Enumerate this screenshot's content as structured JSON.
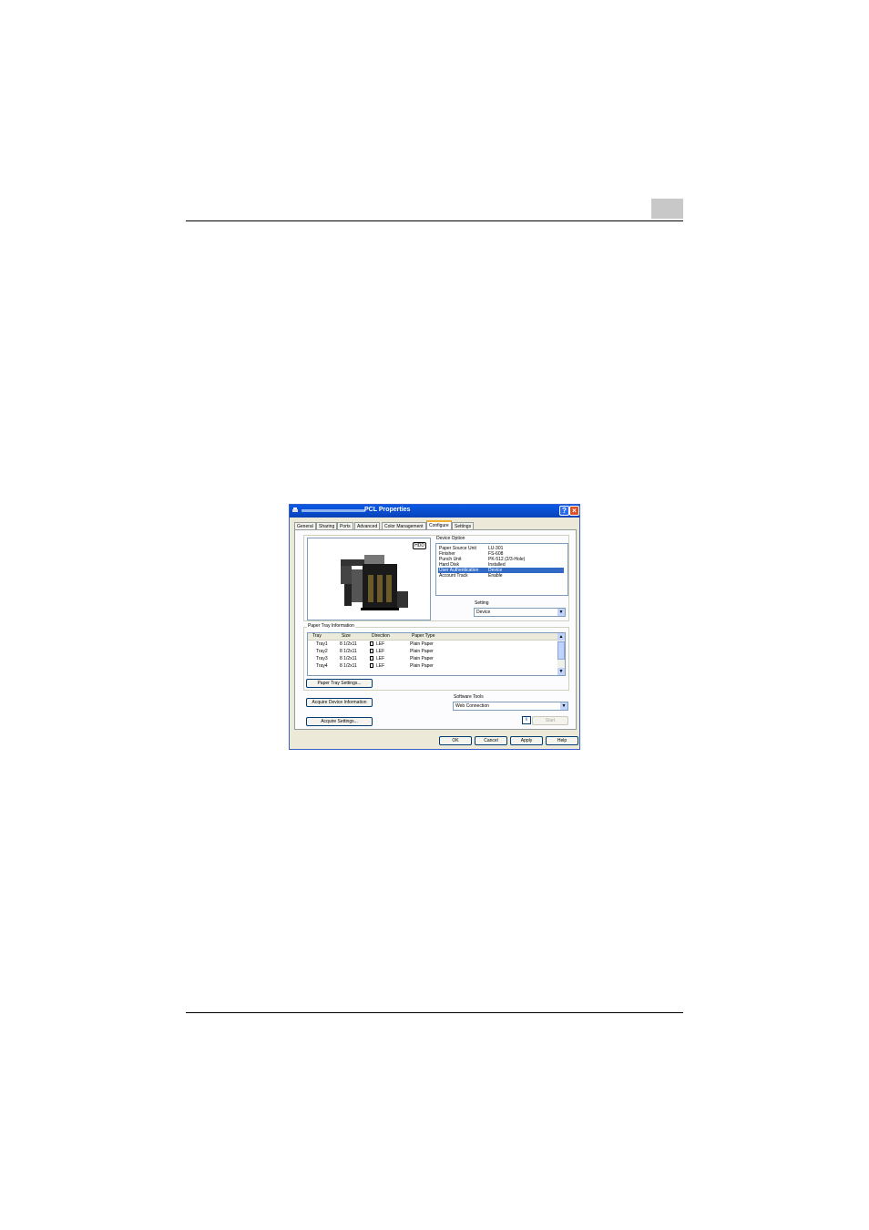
{
  "dialog": {
    "title": "PCL Properties",
    "tabs": [
      "General",
      "Sharing",
      "Ports",
      "Advanced",
      "Color Management",
      "Configure",
      "Settings"
    ],
    "active_tab": "Configure",
    "preview_badge": "HDD",
    "device_option": {
      "label": "Device Option",
      "rows": [
        {
          "name": "Paper Source Unit",
          "value": "LU-301"
        },
        {
          "name": "Finisher",
          "value": "FS-608"
        },
        {
          "name": "Punch Unit",
          "value": "PK-512 (2/3-Hole)"
        },
        {
          "name": "Hard Disk",
          "value": "Installed"
        },
        {
          "name": "User Authentication",
          "value": "Device"
        },
        {
          "name": "Account Track",
          "value": "Enable"
        }
      ],
      "selected_index": 4
    },
    "setting": {
      "label": "Setting",
      "value": "Device"
    },
    "paper_tray": {
      "label": "Paper Tray Information",
      "columns": [
        "Tray",
        "Size",
        "Direction",
        "Paper Type"
      ],
      "rows": [
        {
          "tray": "Tray1",
          "size": "8 1/2x11",
          "direction": "LEF",
          "type": "Plain Paper"
        },
        {
          "tray": "Tray2",
          "size": "8 1/2x11",
          "direction": "LEF",
          "type": "Plain Paper"
        },
        {
          "tray": "Tray3",
          "size": "8 1/2x11",
          "direction": "LEF",
          "type": "Plain Paper"
        },
        {
          "tray": "Tray4",
          "size": "8 1/2x11",
          "direction": "LEF",
          "type": "Plain Paper"
        }
      ],
      "settings_button": "Paper Tray Settings..."
    },
    "acquire_device_button": "Acquire Device Information",
    "acquire_settings_button": "Acquire Settings...",
    "software_tools": {
      "label": "Software Tools",
      "value": "Web Connection",
      "start_button": "Start"
    },
    "buttons": {
      "ok": "OK",
      "cancel": "Cancel",
      "apply": "Apply",
      "help": "Help"
    }
  }
}
